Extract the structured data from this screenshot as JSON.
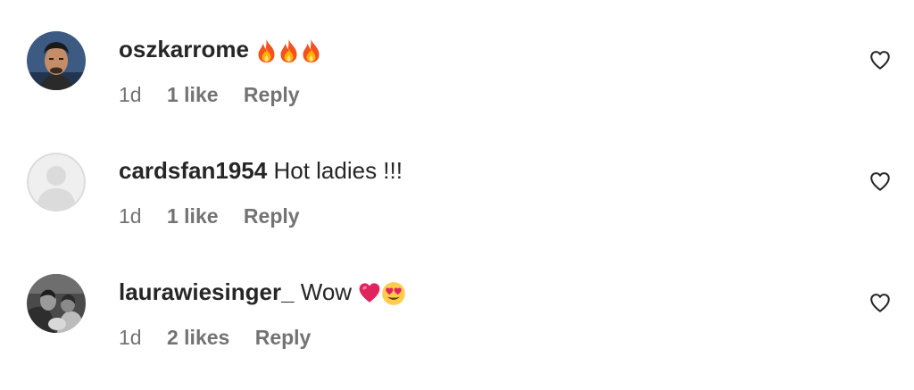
{
  "colors": {
    "text": "#262626",
    "meta": "#737373",
    "placeholder_avatar": "#dbdbdb"
  },
  "comments": [
    {
      "username": "oszkarrome",
      "text": "",
      "emojis": [
        "fire",
        "fire",
        "fire"
      ],
      "time": "1d",
      "likes": "1 like",
      "reply": "Reply",
      "avatar": "profile-photo"
    },
    {
      "username": "cardsfan1954",
      "text": "Hot ladies !!!",
      "emojis": [],
      "time": "1d",
      "likes": "1 like",
      "reply": "Reply",
      "avatar": "default-avatar"
    },
    {
      "username": "laurawiesinger_",
      "text": "Wow",
      "emojis": [
        "red-heart",
        "heart-eyes"
      ],
      "time": "1d",
      "likes": "2 likes",
      "reply": "Reply",
      "avatar": "profile-photo-bw"
    }
  ]
}
